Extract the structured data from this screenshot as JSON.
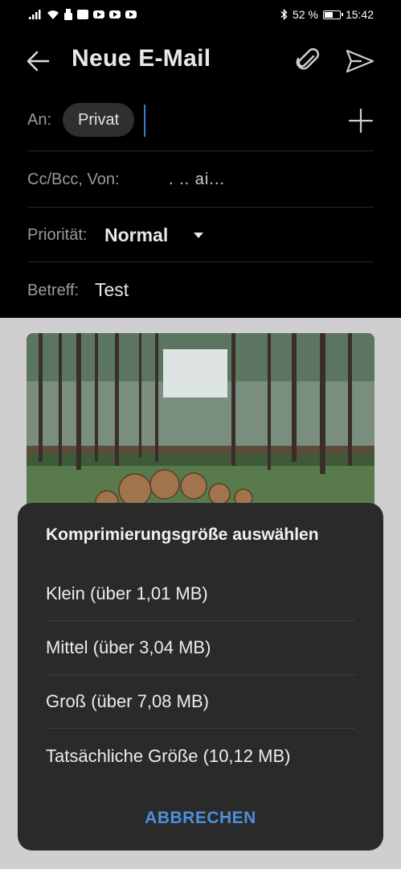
{
  "status_bar": {
    "battery_percent": "52 %",
    "battery_level": 0.52,
    "time": "15:42",
    "icons": [
      "signal-icon",
      "wifi-icon",
      "usb-icon",
      "huawei-icon",
      "youtube-icon",
      "youtube-icon",
      "youtube-icon",
      "bluetooth-icon",
      "battery-icon"
    ]
  },
  "header": {
    "title": "Neue E-Mail",
    "back_icon": "arrow-left-icon",
    "attach_icon": "paperclip-icon",
    "send_icon": "send-icon"
  },
  "fields": {
    "to_label": "An:",
    "to_chip": "Privat",
    "add_icon": "plus-icon",
    "cc_label": "Cc/Bcc, Von:",
    "cc_value": ". .. ai...",
    "priority_label": "Priorität:",
    "priority_value": "Normal",
    "subject_label": "Betreff:",
    "subject_value": "Test"
  },
  "dialog": {
    "title": "Komprimierungsgröße auswählen",
    "options": [
      "Klein (über 1,01 MB)",
      "Mittel (über 3,04 MB)",
      "Groß (über 7,08 MB)",
      "Tatsächliche Größe (10,12 MB)"
    ],
    "cancel": "ABBRECHEN"
  },
  "colors": {
    "background": "#000000",
    "accent": "#4f8fdc",
    "sheet": "#2a2a2a",
    "dim_overlay": "#cfcfcf"
  }
}
